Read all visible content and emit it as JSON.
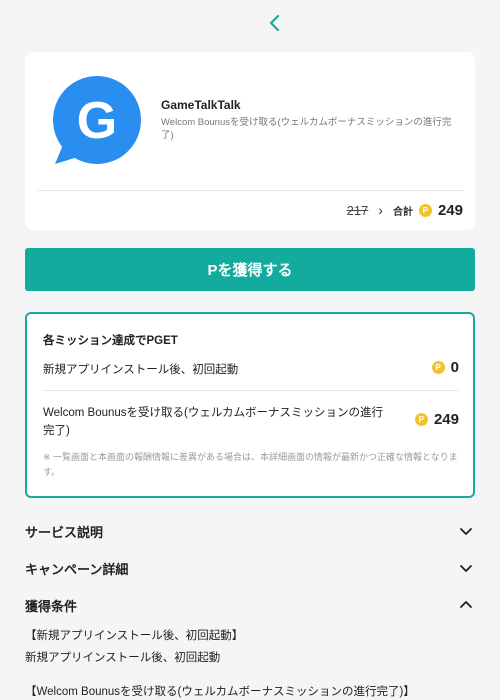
{
  "nav": {
    "back_icon": "chevron-left-icon"
  },
  "app": {
    "name": "GameTalkTalk",
    "description": "Welcom Bounusを受け取る(ウェルカムボーナスミッションの進行完了)",
    "logo_letter": "G",
    "logo_color": "#2a8df0"
  },
  "points": {
    "old": "217",
    "total_label": "合計",
    "coin_letter": "P",
    "total": "249"
  },
  "cta": {
    "label": "Pを獲得する",
    "color": "#12ab9e"
  },
  "missions": {
    "title": "各ミッション達成でPGET",
    "items": [
      {
        "label": "新規アプリインストール後、初回起動",
        "points": "0"
      },
      {
        "label": "Welcom Bounusを受け取る(ウェルカムボーナスミッションの進行完了)",
        "points": "249"
      }
    ],
    "note": "※ 一覧画面と本画面の報酬情報に差異がある場合は、本詳細画面の情報が最新かつ正確な情報となります。"
  },
  "sections": [
    {
      "title": "サービス説明",
      "state": "collapsed"
    },
    {
      "title": "キャンペーン詳細",
      "state": "collapsed"
    },
    {
      "title": "獲得条件",
      "state": "expanded"
    }
  ],
  "conditions": [
    "【新規アプリインストール後、初回起動】",
    "新規アプリインストール後、初回起動",
    "【Welcom Bounusを受け取る(ウェルカムボーナスミッションの進行完了)】"
  ],
  "colors": {
    "accent": "#12ab9e",
    "coin": "#f4c32a",
    "background": "#f5f5f5"
  }
}
